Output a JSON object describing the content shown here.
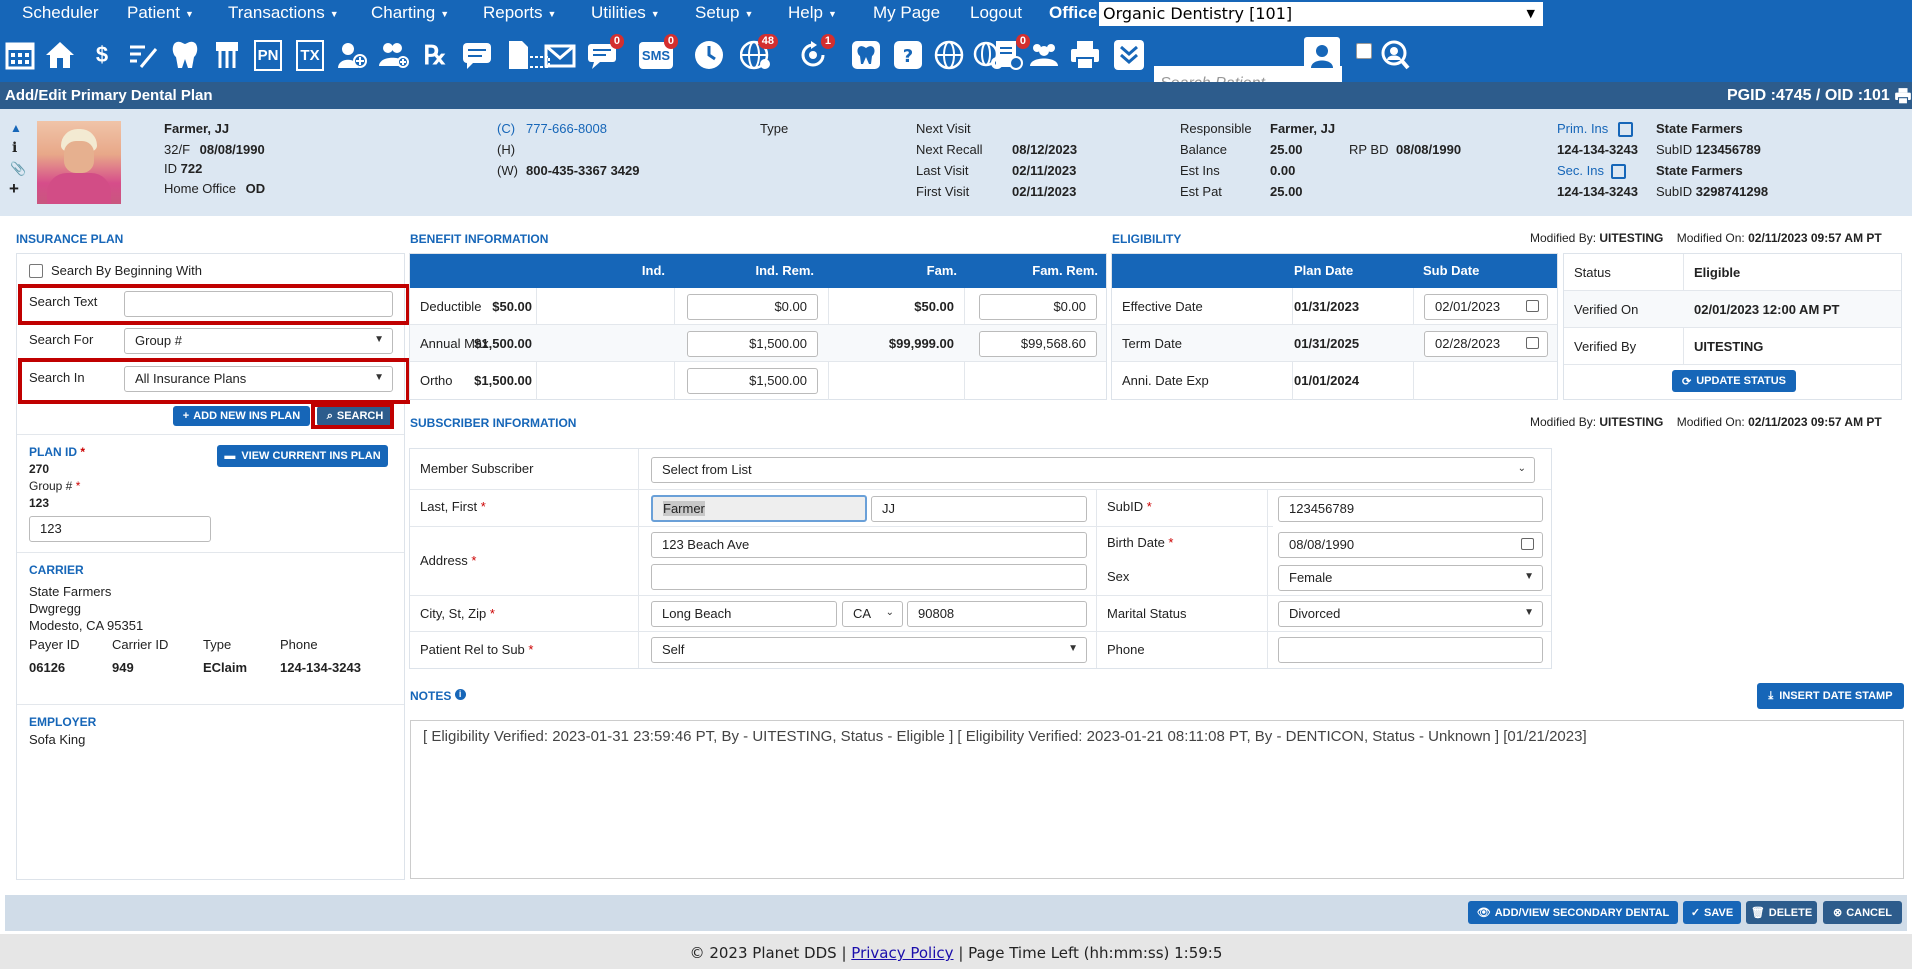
{
  "menu": {
    "items": [
      "Scheduler",
      "Patient",
      "Transactions",
      "Charting",
      "Reports",
      "Utilities",
      "Setup",
      "Help",
      "My Page",
      "Logout"
    ],
    "office_label": "Office",
    "office_value": "Organic Dentistry [101]"
  },
  "toolbar": {
    "badges": {
      "messages": "0",
      "sms": "0",
      "web": "48",
      "recall": "1",
      "forms": "0"
    },
    "sms_label": "SMS",
    "search_placeholder": "Search Patient..."
  },
  "page": {
    "title": "Add/Edit Primary Dental Plan",
    "pgid_oid": "PGID :4745  /  OID :101"
  },
  "patient": {
    "name": "Farmer, JJ",
    "age_sex": "32/F",
    "dob": "08/08/1990",
    "id_label": "ID",
    "id": "722",
    "home_office_label": "Home Office",
    "home_office": "OD",
    "phone_c_label": "(C)",
    "phone_c": "777-666-8008",
    "phone_h_label": "(H)",
    "phone_w_label": "(W)",
    "phone_w": "800-435-3367 3429",
    "type_label": "Type",
    "next_visit_label": "Next Visit",
    "next_recall_label": "Next Recall",
    "next_recall": "08/12/2023",
    "last_visit_label": "Last Visit",
    "last_visit": "02/11/2023",
    "first_visit_label": "First Visit",
    "first_visit": "02/11/2023",
    "responsible_label": "Responsible",
    "responsible": "Farmer, JJ",
    "balance_label": "Balance",
    "balance": "25.00",
    "rp_bd_label": "RP BD",
    "rp_bd": "08/08/1990",
    "est_ins_label": "Est Ins",
    "est_ins": "0.00",
    "est_pat_label": "Est Pat",
    "est_pat": "25.00",
    "prim_ins_label": "Prim. Ins",
    "prim_ins": "State Farmers",
    "prim_phone": "124-134-3243",
    "prim_subid_label": "SubID",
    "prim_subid": "123456789",
    "sec_ins_label": "Sec. Ins",
    "sec_ins": "State Farmers",
    "sec_phone": "124-134-3243",
    "sec_subid_label": "SubID",
    "sec_subid": "3298741298"
  },
  "insurance_plan": {
    "header": "INSURANCE PLAN",
    "search_by_beginning": "Search By Beginning With",
    "search_text_label": "Search Text",
    "search_text_value": "",
    "search_for_label": "Search For",
    "search_for_value": "Group #",
    "search_in_label": "Search In",
    "search_in_value": "All Insurance Plans",
    "add_new_label": "ADD NEW INS PLAN",
    "search_label": "SEARCH",
    "plan_id_label": "PLAN ID",
    "plan_id": "270",
    "group_label": "Group #",
    "group": "123",
    "group_input": "123",
    "view_current_label": "VIEW CURRENT INS PLAN",
    "carrier_header": "CARRIER",
    "carrier_name": "State Farmers",
    "carrier_addr1": "Dwgregg",
    "carrier_addr2": "Modesto, CA 95351",
    "payer_id_label": "Payer ID",
    "payer_id": "06126",
    "carrier_id_label": "Carrier ID",
    "carrier_id": "949",
    "type_label": "Type",
    "type": "EClaim",
    "phone_label": "Phone",
    "phone": "124-134-3243",
    "employer_header": "EMPLOYER",
    "employer": "Sofa King"
  },
  "benefit": {
    "header": "BENEFIT INFORMATION",
    "columns": [
      "Ind.",
      "Ind. Rem.",
      "Fam.",
      "Fam. Rem."
    ],
    "rows": [
      {
        "label": "Deductible",
        "ind": "$50.00",
        "ind_rem": "$0.00",
        "fam": "$50.00",
        "fam_rem": "$0.00"
      },
      {
        "label": "Annual Max.",
        "ind": "$1,500.00",
        "ind_rem": "$1,500.00",
        "fam": "$99,999.00",
        "fam_rem": "$99,568.60"
      },
      {
        "label": "Ortho",
        "ind": "$1,500.00",
        "ind_rem": "$1,500.00",
        "fam": "",
        "fam_rem": ""
      }
    ]
  },
  "eligibility": {
    "header": "ELIGIBILITY",
    "modified_by_label": "Modified By:",
    "modified_by": "UITESTING",
    "modified_on_label": "Modified On:",
    "modified_on": "02/11/2023 09:57 AM PT",
    "columns": [
      "Plan Date",
      "Sub Date"
    ],
    "rows": [
      {
        "label": "Effective Date",
        "plan": "01/31/2023",
        "sub": "02/01/2023"
      },
      {
        "label": "Term Date",
        "plan": "01/31/2025",
        "sub": "02/28/2023"
      },
      {
        "label": "Anni. Date Exp",
        "plan": "01/01/2024",
        "sub": ""
      }
    ],
    "status_label": "Status",
    "status": "Eligible",
    "verified_on_label": "Verified On",
    "verified_on": "02/01/2023 12:00 AM PT",
    "verified_by_label": "Verified By",
    "verified_by": "UITESTING",
    "update_status_label": "UPDATE STATUS"
  },
  "subscriber": {
    "header": "SUBSCRIBER INFORMATION",
    "modified_by_label": "Modified By:",
    "modified_by": "UITESTING",
    "modified_on_label": "Modified On:",
    "modified_on": "02/11/2023 09:57 AM PT",
    "member_label": "Member Subscriber",
    "member_value": "Select from List",
    "name_label": "Last, First",
    "last": "Farmer",
    "first": "JJ",
    "subid_label": "SubID",
    "subid": "123456789",
    "address_label": "Address",
    "address1": "123 Beach Ave",
    "address2": "",
    "birth_label": "Birth Date",
    "birth": "08/08/1990",
    "sex_label": "Sex",
    "sex": "Female",
    "city_label": "City, St, Zip",
    "city": "Long Beach",
    "state": "CA",
    "zip": "90808",
    "marital_label": "Marital Status",
    "marital": "Divorced",
    "rel_label": "Patient Rel to Sub",
    "rel": "Self",
    "phone_label": "Phone",
    "phone": ""
  },
  "notes": {
    "header": "NOTES",
    "insert_date_label": "INSERT DATE STAMP",
    "text": "[ Eligibility Verified: 2023-01-31 23:59:46 PT, By - UITESTING, Status - Eligible ] [ Eligibility Verified: 2023-01-21 08:11:08 PT, By - DENTICON, Status - Unknown ] [01/21/2023]"
  },
  "actions": {
    "secondary_label": "ADD/VIEW SECONDARY DENTAL",
    "save_label": "SAVE",
    "delete_label": "DELETE",
    "cancel_label": "CANCEL"
  },
  "footer": {
    "copyright": "© 2023 Planet DDS |",
    "privacy": "Privacy Policy",
    "time_left": "|  Page Time Left (hh:mm:ss) 1:59:5"
  }
}
